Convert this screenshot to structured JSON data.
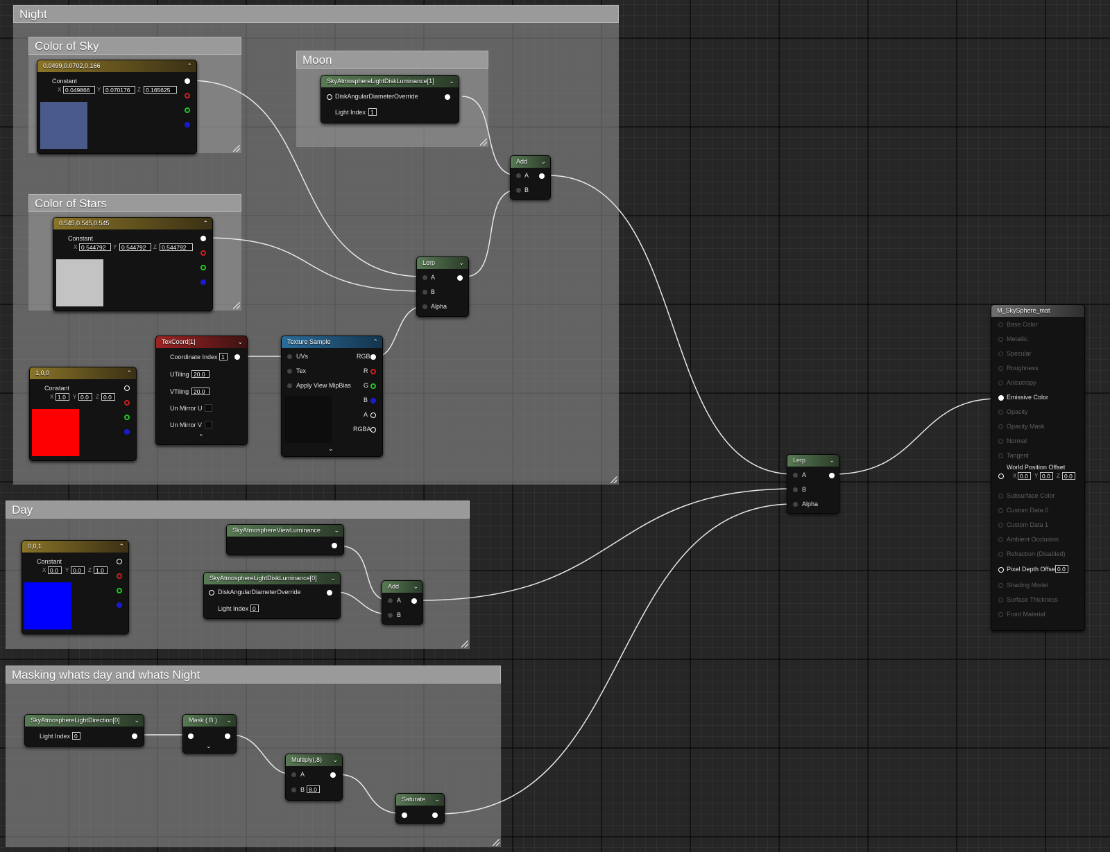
{
  "comments": {
    "night": "Night",
    "color_of_sky": "Color of Sky",
    "moon": "Moon",
    "color_of_stars": "Color of Stars",
    "day": "Day",
    "masking": "Masking whats day and whats Night"
  },
  "common": {
    "constant": "Constant",
    "x": "X",
    "y": "Y",
    "z": "Z",
    "a": "A",
    "b": "B",
    "alpha": "Alpha"
  },
  "sky_color": {
    "title": "0.0499,0.0702,0.166",
    "x": "0.049866",
    "y": "0.070176",
    "z": "0.165625",
    "swatch": "#4a5a8a"
  },
  "stars_color": {
    "title": "0.545,0.545,0.545",
    "x": "0.544792",
    "y": "0.544792",
    "z": "0.544792",
    "swatch": "#c3c3c3"
  },
  "red_const": {
    "title": "1,0,0",
    "x": "1.0",
    "y": "0.0",
    "z": "0.0",
    "swatch": "#ff0000"
  },
  "blue_const": {
    "title": "0,0,1",
    "x": "0.0",
    "y": "0.0",
    "z": "1.0",
    "swatch": "#0000ff"
  },
  "moon_disk": {
    "title": "SkyAtmosphereLightDiskLuminance[1]",
    "input": "DiskAngularDiameterOverride",
    "light_index_label": "Light Index",
    "light_index": "1"
  },
  "add_night": {
    "title": "Add"
  },
  "lerp_night": {
    "title": "Lerp"
  },
  "texcoord": {
    "title": "TexCoord[1]",
    "coord_index_label": "Coordinate Index",
    "coord_index": "1",
    "utiling_label": "UTiling",
    "utiling": "20.0",
    "vtiling_label": "VTiling",
    "vtiling": "20.0",
    "unmirror_u": "Un Mirror U",
    "unmirror_v": "Un Mirror V"
  },
  "texture_sample": {
    "title": "Texture Sample",
    "uvs": "UVs",
    "tex": "Tex",
    "mipbias": "Apply View MipBias",
    "rgb": "RGB",
    "r": "R",
    "g": "G",
    "b": "B",
    "a": "A",
    "rgba": "RGBA"
  },
  "view_lum": {
    "title": "SkyAtmosphereViewLuminance"
  },
  "day_disk": {
    "title": "SkyAtmosphereLightDiskLuminance[0]",
    "input": "DiskAngularDiameterOverride",
    "light_index_label": "Light Index",
    "light_index": "0"
  },
  "add_day": {
    "title": "Add"
  },
  "light_dir": {
    "title": "SkyAtmosphereLightDirection[0]",
    "light_index_label": "Light Index",
    "light_index": "0"
  },
  "mask": {
    "title": "Mask ( B )"
  },
  "multiply": {
    "title": "Multiply(,8)",
    "b_value": "8.0"
  },
  "saturate": {
    "title": "Saturate"
  },
  "lerp_main": {
    "title": "Lerp"
  },
  "material": {
    "title": "M_SkySphere_mat",
    "pins": [
      "Base Color",
      "Metallic",
      "Specular",
      "Roughness",
      "Anisotropy",
      "Emissive Color",
      "Opacity",
      "Opacity Mask",
      "Normal",
      "Tangent",
      "World Position Offset",
      "Subsurface Color",
      "Custom Data 0",
      "Custom Data 1",
      "Ambient Occlusion",
      "Refraction (Disabled)",
      "Pixel Depth Offset",
      "Shading Model",
      "Surface Thickness",
      "Front Material"
    ],
    "wpo": {
      "x": "0.0",
      "y": "0.0",
      "z": "0.0"
    },
    "pdo": "0.0"
  }
}
